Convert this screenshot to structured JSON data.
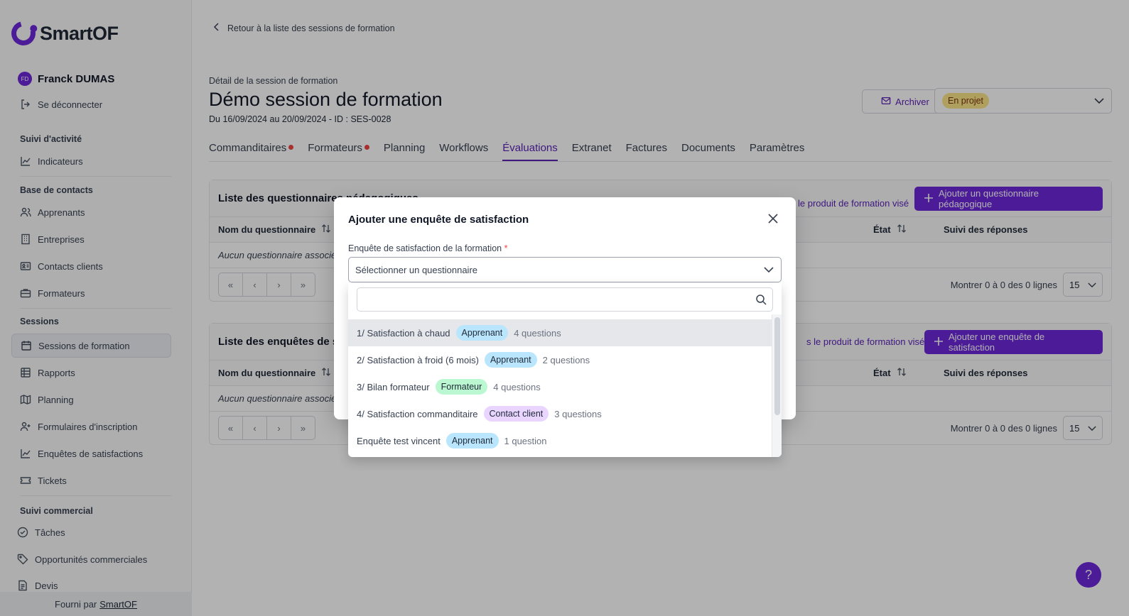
{
  "sidebar": {
    "logo": "SmartOF",
    "user": {
      "initials": "FD",
      "name": "Franck DUMAS"
    },
    "logout": "Se déconnecter",
    "sections": [
      {
        "title": "Suivi d'activité"
      },
      {
        "title": "Base de contacts"
      },
      {
        "title": "Sessions"
      },
      {
        "title": "Suivi commercial"
      }
    ],
    "items": [
      {
        "label": "Indicateurs",
        "icon": "chart-line-icon"
      },
      {
        "label": "Apprenants",
        "icon": "users-icon"
      },
      {
        "label": "Entreprises",
        "icon": "building-icon"
      },
      {
        "label": "Contacts clients",
        "icon": "contact-card-icon"
      },
      {
        "label": "Formateurs",
        "icon": "briefcase-icon"
      },
      {
        "label": "Sessions de formation",
        "icon": "calendar-icon"
      },
      {
        "label": "Rapports",
        "icon": "table-icon"
      },
      {
        "label": "Planning",
        "icon": "map-icon"
      },
      {
        "label": "Formulaires d'inscription",
        "icon": "user-plus-icon"
      },
      {
        "label": "Enquêtes de satisfactions",
        "icon": "chart-line-icon"
      },
      {
        "label": "Tickets",
        "icon": "ticket-icon"
      },
      {
        "label": "Tâches",
        "icon": "check-circle-icon"
      },
      {
        "label": "Opportunités commerciales",
        "icon": "tag-icon"
      },
      {
        "label": "Devis",
        "icon": "document-icon"
      }
    ],
    "footer": {
      "prefix": "Fourni par",
      "link": "SmartOF"
    }
  },
  "header": {
    "back": "Retour à la liste des sessions de formation",
    "subtitle": "Détail de la session de formation",
    "title": "Démo session de formation",
    "dates": "Du 16/09/2024 au 20/09/2024 - ID : SES-0028",
    "archive": "Archiver",
    "status": "En projet"
  },
  "tabs": [
    "Commanditaires",
    "Formateurs",
    "Planning",
    "Workflows",
    "Évaluations",
    "Extranet",
    "Factures",
    "Documents",
    "Paramètres"
  ],
  "card1": {
    "title": "Liste des questionnaires pédagogiques",
    "link": "le produit de formation visé",
    "button": "Ajouter un questionnaire pédagogique",
    "columns": [
      "Nom du questionnaire",
      "État",
      "Suivi des réponses"
    ],
    "empty": "Aucun questionnaire associé",
    "showing": "Montrer 0 à 0 des 0 lignes",
    "page_size": "15"
  },
  "card2": {
    "title": "Liste des enquêtes de satisfaction",
    "link": "s le produit de formation visé",
    "button": "Ajouter une enquête de satisfaction",
    "columns": [
      "Nom du questionnaire",
      "État",
      "Suivi des réponses"
    ],
    "empty": "Aucun questionnaire associé",
    "showing": "Montrer 0 à 0 des 0 lignes",
    "page_size": "15"
  },
  "pager": {
    "first": "«",
    "prev": "‹",
    "next": "›",
    "last": "»"
  },
  "modal": {
    "title": "Ajouter une enquête de satisfaction",
    "field_label": "Enquête de satisfaction de la formation",
    "required": "*",
    "placeholder": "Sélectionner un questionnaire",
    "options": [
      {
        "name": "1/ Satisfaction à chaud",
        "badge": "Apprenant",
        "count": "4 questions"
      },
      {
        "name": "2/ Satisfaction à froid (6 mois)",
        "badge": "Apprenant",
        "count": "2 questions"
      },
      {
        "name": "3/ Bilan formateur",
        "badge": "Formateur",
        "count": "4 questions"
      },
      {
        "name": "4/ Satisfaction commanditaire",
        "badge": "Contact client",
        "count": "3 questions"
      },
      {
        "name": "Enquête test vincent",
        "badge": "Apprenant",
        "count": "1 question"
      }
    ]
  },
  "help": "?"
}
